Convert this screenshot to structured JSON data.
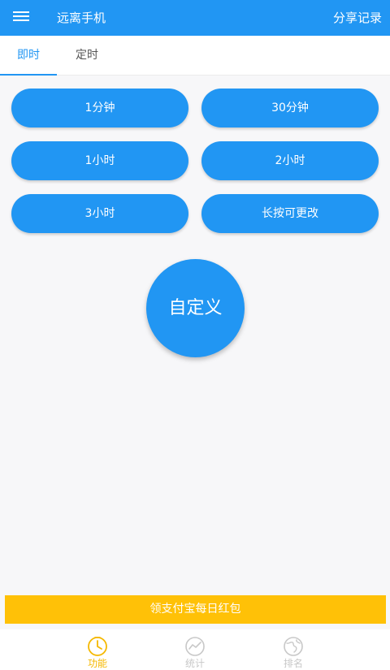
{
  "appbar": {
    "title": "远离手机",
    "share_label": "分享记录",
    "menu_icon": "menu-icon"
  },
  "tabs": [
    {
      "label": "即时",
      "active": true
    },
    {
      "label": "定时",
      "active": false
    }
  ],
  "durations": [
    "1分钟",
    "30分钟",
    "1小时",
    "2小时",
    "3小时",
    "长按可更改"
  ],
  "custom_label": "自定义",
  "banner_label": "领支付宝每日红包",
  "bottom_nav": [
    {
      "label": "功能",
      "icon": "timer-icon",
      "active": true
    },
    {
      "label": "统计",
      "icon": "chart-icon",
      "active": false
    },
    {
      "label": "排名",
      "icon": "globe-icon",
      "active": false
    }
  ],
  "colors": {
    "primary": "#2196F3",
    "accent": "#FFC107",
    "active_nav": "#F5B800",
    "inactive_nav": "#C8C8C8",
    "background": "#F7F7F9"
  }
}
